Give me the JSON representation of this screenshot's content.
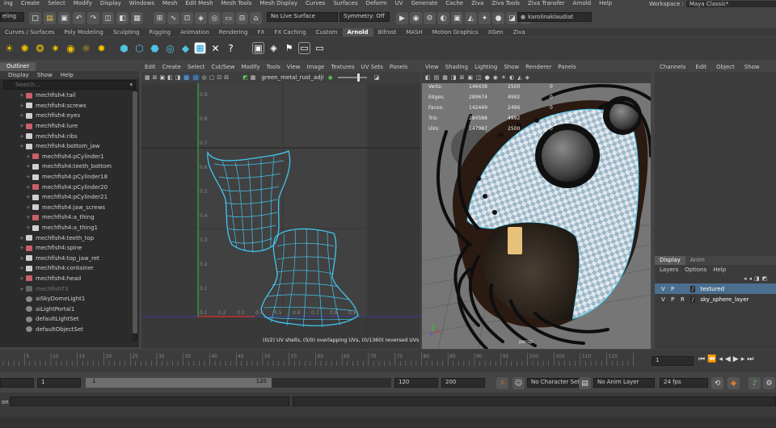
{
  "menus": [
    "ing",
    "Create",
    "Select",
    "Modify",
    "Display",
    "Windows",
    "Mesh",
    "Edit Mesh",
    "Mesh Tools",
    "Mesh Display",
    "Curves",
    "Surfaces",
    "Deform",
    "UV",
    "Generate",
    "Cache",
    "Ziva",
    "Ziva Tools",
    "Ziva Transfer",
    "Arnold",
    "Help"
  ],
  "workspace": {
    "label": "Workspace :",
    "value": "Maya Classic*"
  },
  "status": {
    "mode": "eling",
    "live_surface": "No Live Surface",
    "symmetry": "Symmetry: Off",
    "user": "karolinaklaudiat"
  },
  "shelf_tabs": [
    "Curves / Surfaces",
    "Poly Modeling",
    "Sculpting",
    "Rigging",
    "Animation",
    "Rendering",
    "FX",
    "FX Caching",
    "Custom",
    "Arnold",
    "Bifrost",
    "MASH",
    "Motion Graphics",
    "XGen",
    "Ziva"
  ],
  "active_shelf": "Arnold",
  "outliner": {
    "title": "Outliner",
    "menu": [
      "Display",
      "Show",
      "Help"
    ],
    "search_placeholder": "Search...",
    "items": [
      "mechfish4:tail",
      "mechfish4:screws",
      "mechfish4:eyes",
      "mechfish4:lure",
      "mechfish4:ribs",
      "mechfish4:bottom_jaw",
      "mechfish4:pCylinder1",
      "mechfish4:teeth_bottom",
      "mechfish4:pCylinder18",
      "mechfish4:pCylinder20",
      "mechfish4:pCylinder21",
      "mechfish4:jaw_screws",
      "mechfish4:a_thing",
      "mechfish4:a_thing1",
      "mechfish4:teeth_top",
      "mechfish4:spine",
      "mechfish4:top_jaw_ret",
      "mechfish4:container",
      "mechfish4:head",
      "mechfishTX",
      "aiSkyDomeLight1",
      "aiLightPortal1",
      "defaultLightSet",
      "defaultObjectSet"
    ]
  },
  "uv_editor": {
    "menu": [
      "Edit",
      "Create",
      "Select",
      "Cut/Sew",
      "Modify",
      "Tools",
      "View",
      "Image",
      "Textures",
      "UV Sets",
      "Panels"
    ],
    "texture_name": "green_metal_rust_adji",
    "status_text": "(0/2) UV shells, (0/0) overlapping UVs, (0/1360) reversed UVs",
    "axis_labels": [
      "0.1",
      "0.2",
      "0.3",
      "0.4",
      "0.5",
      "0.6",
      "0.7",
      "0.8",
      "0.9"
    ]
  },
  "viewport": {
    "menu": [
      "View",
      "Shading",
      "Lighting",
      "Show",
      "Renderer",
      "Panels"
    ],
    "stats": [
      {
        "label": "Verts:",
        "a": "146438",
        "b": "2500",
        "c": "0"
      },
      {
        "label": "Edges:",
        "a": "289674",
        "b": "4992",
        "c": "0"
      },
      {
        "label": "Faces:",
        "a": "142449",
        "b": "2496",
        "c": "0"
      },
      {
        "label": "Tris:",
        "a": "284588",
        "b": "4992",
        "c": "0"
      },
      {
        "label": "UVs:",
        "a": "147987",
        "b": "2500",
        "c": "0"
      }
    ],
    "camera": "persp"
  },
  "channel_box": {
    "menu": [
      "Channels",
      "Edit",
      "Object",
      "Show"
    ],
    "layer_tabs": [
      "Display",
      "Anim"
    ],
    "layer_menu": [
      "Layers",
      "Options",
      "Help"
    ],
    "layers": [
      {
        "v": "V",
        "p": "P",
        "r": "",
        "name": "textured"
      },
      {
        "v": "V",
        "p": "P",
        "r": "R",
        "name": "sky_sphere_layer"
      }
    ]
  },
  "timeline": {
    "ticks": [
      "5",
      "10",
      "15",
      "20",
      "25",
      "30",
      "35",
      "40",
      "45",
      "50",
      "55",
      "60",
      "65",
      "70",
      "75",
      "80",
      "85",
      "90",
      "95",
      "100",
      "105",
      "110",
      "115"
    ],
    "current_frame": "1"
  },
  "range": {
    "start": "1",
    "inner_start": "1",
    "slider_value": "120",
    "end_inner": "120",
    "end": "200",
    "char_set": "No Character Set",
    "anim_layer": "No Anim Layer",
    "fps": "24 fps"
  },
  "cmdline": {
    "label": "on"
  }
}
